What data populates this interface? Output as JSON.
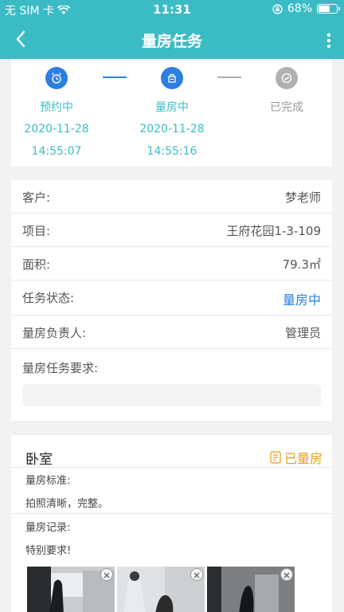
{
  "status_bar": {
    "carrier": "无 SIM 卡",
    "time": "11:31",
    "battery_percent": "68%",
    "battery_level": 0.68
  },
  "nav": {
    "title": "量房任务"
  },
  "progress": {
    "steps": [
      {
        "label": "预约中",
        "date": "2020-11-28",
        "time": "14:55:07",
        "state": "done",
        "icon": "alarm-clock-icon"
      },
      {
        "label": "量房中",
        "date": "2020-11-28",
        "time": "14:55:16",
        "state": "current",
        "icon": "measure-icon"
      },
      {
        "label": "已完成",
        "date": "",
        "time": "",
        "state": "pending",
        "icon": "check-circle-icon"
      }
    ]
  },
  "info": {
    "customer_label": "客户:",
    "customer_value": "梦老师",
    "project_label": "项目:",
    "project_value": "王府花园1-3-109",
    "area_label": "面积:",
    "area_value": "79.3㎡",
    "status_label": "任务状态:",
    "status_value": "量房中",
    "owner_label": "量房负责人:",
    "owner_value": "管理员",
    "requirement_label": "量房任务要求:",
    "requirement_value": ""
  },
  "room": {
    "title": "卧室",
    "status": "已量房",
    "standard_label": "量房标准:",
    "standard_value": "拍照清晰，完整。",
    "record_label": "量房记录:",
    "record_value": "特别要求!"
  },
  "colors": {
    "primary": "#3bbcc5",
    "step_blue": "#2c7fe0",
    "pending_gray": "#b0b0b0",
    "status_blue": "#2c7fe0",
    "room_status": "#e4a11b"
  }
}
